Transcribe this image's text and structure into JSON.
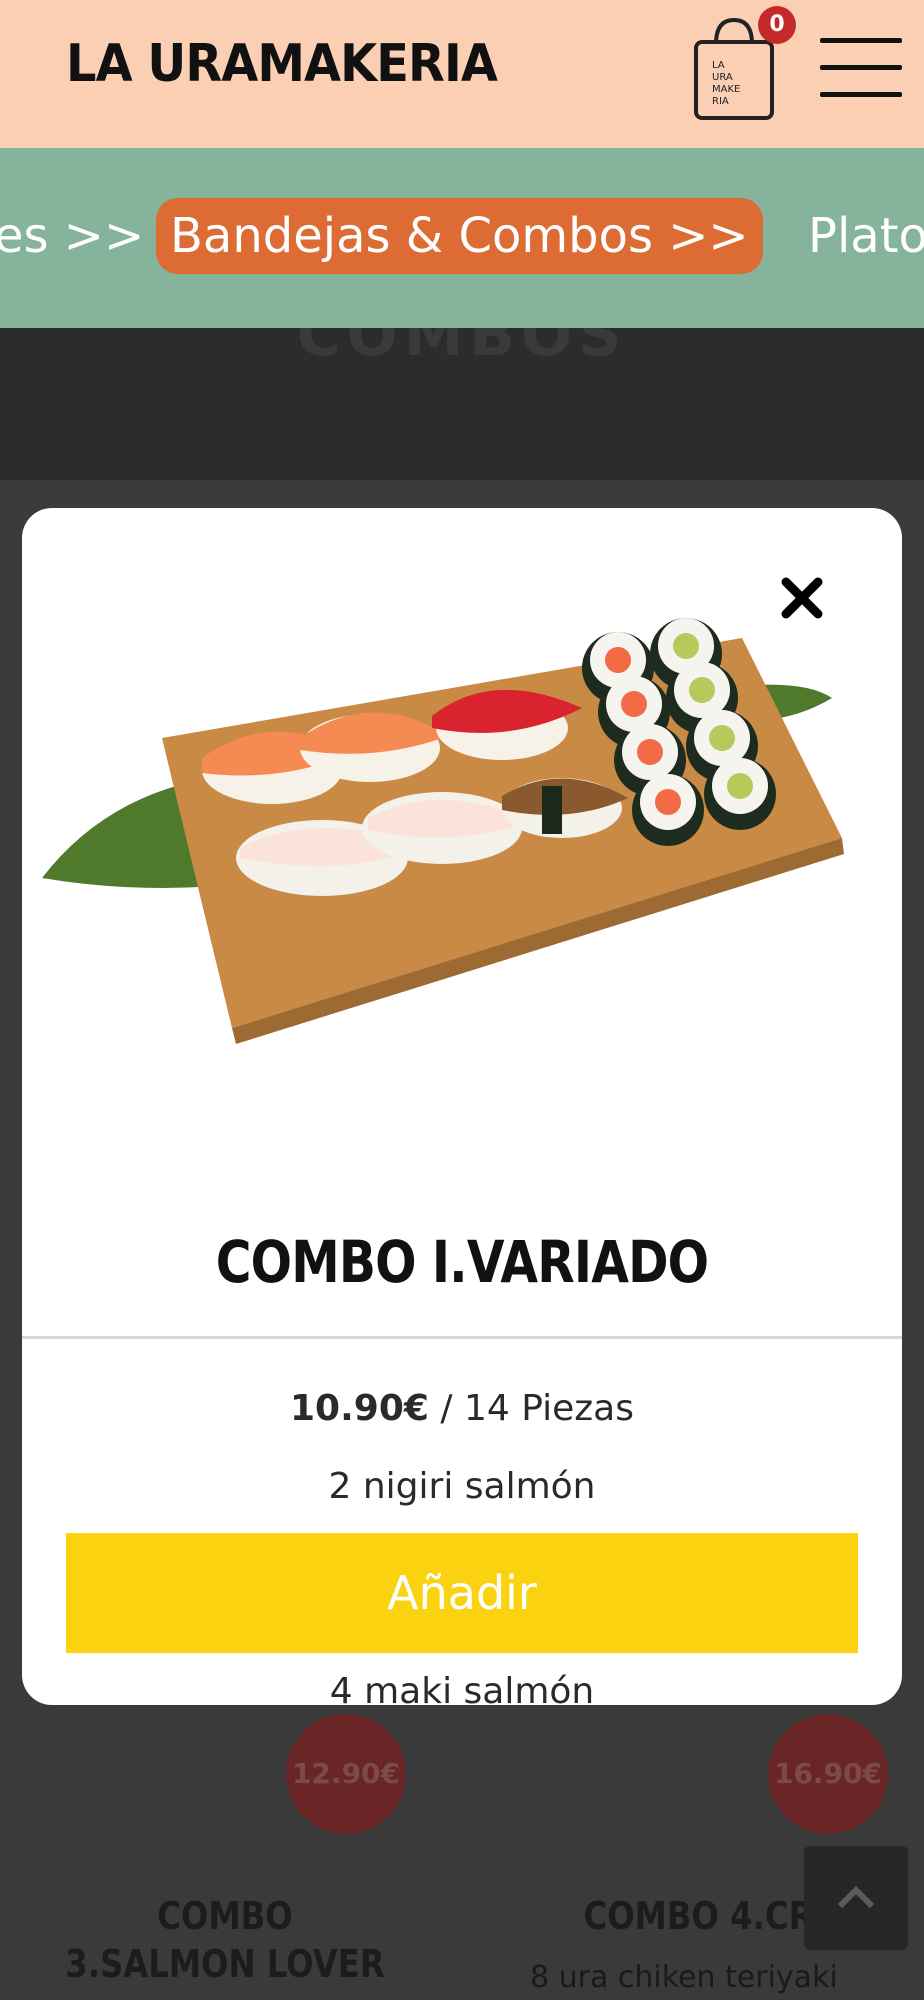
{
  "header": {
    "logo_text": "LA URAMAKERIA",
    "cart_count": "0",
    "cart_bag_text": [
      "LA",
      "URA",
      "MAKE",
      "RIA"
    ]
  },
  "categories": [
    {
      "label": "es >>",
      "active": false
    },
    {
      "label": "Bandejas & Combos >>",
      "active": true
    },
    {
      "label": "Plato",
      "active": false
    }
  ],
  "background": {
    "section_title": "COMBOS",
    "cards": [
      {
        "price": "12.90€",
        "name": "COMBO 3.SALMON LOVER"
      },
      {
        "price": "16.90€",
        "name": "COMBO 4.CRIS",
        "desc": "8 ura chiken teriyaki"
      }
    ]
  },
  "modal": {
    "title": "COMBO I.VARIADO",
    "price": "10.90€",
    "unit": "/ 14 Piezas",
    "items": [
      "2 nigiri salmón",
      "4 maki salmón"
    ],
    "add_label": "Añadir"
  },
  "colors": {
    "header_bg": "#fbcfb4",
    "category_bar_bg": "#86b39b",
    "active_category_bg": "#dc6b34",
    "badge_bg": "#c52a2a",
    "add_button_bg": "#fbd20f"
  }
}
